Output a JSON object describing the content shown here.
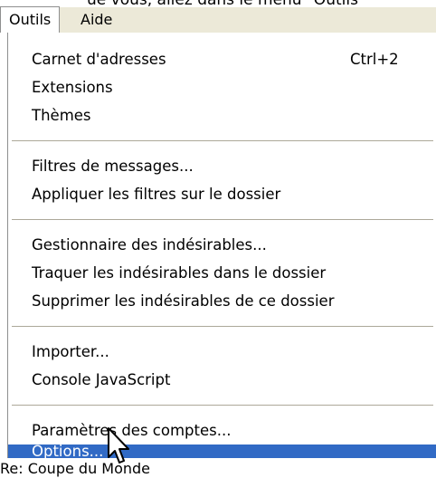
{
  "background_text": "ue vous, allez dans le menu \"Outils\"",
  "menubar": {
    "items": [
      {
        "label": "Outils"
      },
      {
        "label": "Aide"
      }
    ]
  },
  "menu": {
    "items": [
      {
        "label": "Carnet d'adresses",
        "shortcut": "Ctrl+2"
      },
      {
        "label": "Extensions"
      },
      {
        "label": "Thèmes"
      },
      {
        "label": "Filtres de messages..."
      },
      {
        "label": "Appliquer les filtres sur le dossier"
      },
      {
        "label": "Gestionnaire des indésirables..."
      },
      {
        "label": "Traquer les indésirables dans le dossier"
      },
      {
        "label": "Supprimer les indésirables de ce dossier"
      },
      {
        "label": "Importer..."
      },
      {
        "label": "Console JavaScript"
      },
      {
        "label": "Paramètres des comptes..."
      },
      {
        "label": "Options..."
      }
    ],
    "highlighted_item": "Options...",
    "highlight_color": "#316ac5"
  },
  "status_text": "Re: Coupe du Monde",
  "icons": {
    "cursor": "mouse-pointer-icon"
  }
}
